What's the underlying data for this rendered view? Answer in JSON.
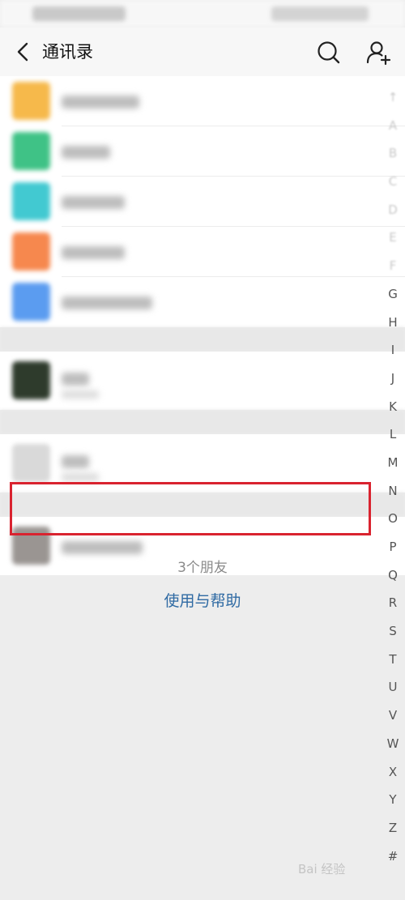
{
  "header": {
    "title": "通讯录"
  },
  "list": {
    "rows": [
      {
        "avatar_color": "#f6b94b",
        "name_width": 96
      },
      {
        "avatar_color": "#3fc286",
        "name_width": 60
      },
      {
        "avatar_color": "#42c9d1",
        "name_width": 78
      },
      {
        "avatar_color": "#f6884e",
        "name_width": 78
      },
      {
        "avatar_color": "#5b9cf0",
        "name_width": 112
      }
    ],
    "contacts": [
      {
        "avatar_color": "#2e3b2c",
        "name_width": 34,
        "sub_width": 46
      },
      {
        "avatar_color": "#d9d9d9",
        "name_width": 34,
        "sub_width": 46
      },
      {
        "avatar_color": "#9a9592",
        "name_width": 100,
        "sub_width": 0
      }
    ]
  },
  "footer": {
    "friend_count": "3个朋友",
    "help_link": "使用与帮助"
  },
  "index_bar": {
    "letters": [
      "↑",
      "A",
      "B",
      "C",
      "D",
      "E",
      "F",
      "G",
      "H",
      "I",
      "J",
      "K",
      "L",
      "M",
      "N",
      "O",
      "P",
      "Q",
      "R",
      "S",
      "T",
      "U",
      "V",
      "W",
      "X",
      "Y",
      "Z",
      "#"
    ],
    "faded_count": 7
  },
  "watermark": "Bai 经验"
}
